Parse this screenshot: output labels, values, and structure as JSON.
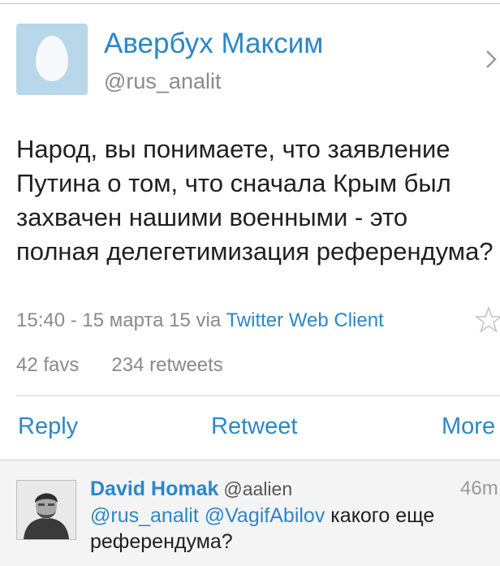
{
  "tweet": {
    "author_name": "Авербух Максим",
    "author_handle": "@rus_analit",
    "text": "Народ, вы понимаете, что заявление Путина о том, что сначала Крым был захвачен нашими военными - это полная делегетимизация референдума?",
    "timestamp": "15:40 - 15 марта 15",
    "via_label": "via",
    "client": "Twitter Web Client",
    "favs": "42 favs",
    "retweets": "234 retweets"
  },
  "actions": {
    "reply": "Reply",
    "retweet": "Retweet",
    "more": "More"
  },
  "reply": {
    "author_name": "David Homak",
    "author_handle": "@aalien",
    "time": "46m",
    "mention1": "@rus_analit",
    "mention2": "@VagifAbilov",
    "text": "какого еще референдума?"
  },
  "colors": {
    "link": "#2b87c8",
    "secondary_text": "#8a8a8a",
    "reply_background": "#f4f4f4",
    "egg_avatar_background": "#b9d7ea"
  },
  "icons": {
    "default_avatar": "egg-avatar-icon",
    "chevron": "chevron-right-icon",
    "favorite": "star-outline-icon"
  }
}
